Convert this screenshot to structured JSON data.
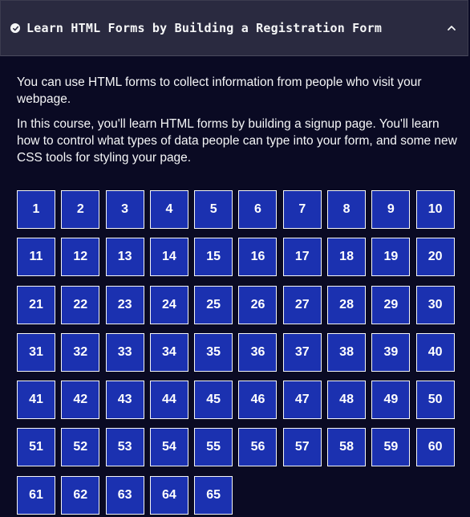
{
  "header": {
    "title": "Learn HTML Forms by Building a Registration Form",
    "completed_icon": "check-circle-icon",
    "toggle_icon": "chevron-up-icon"
  },
  "description": {
    "paragraphs": [
      "You can use HTML forms to collect information from people who visit your webpage.",
      "In this course, you'll learn HTML forms by building a signup page. You'll learn how to control what types of data people can type into your form, and some new CSS tools for styling your page."
    ]
  },
  "steps": [
    "1",
    "2",
    "3",
    "4",
    "5",
    "6",
    "7",
    "8",
    "9",
    "10",
    "11",
    "12",
    "13",
    "14",
    "15",
    "16",
    "17",
    "18",
    "19",
    "20",
    "21",
    "22",
    "23",
    "24",
    "25",
    "26",
    "27",
    "28",
    "29",
    "30",
    "31",
    "32",
    "33",
    "34",
    "35",
    "36",
    "37",
    "38",
    "39",
    "40",
    "41",
    "42",
    "43",
    "44",
    "45",
    "46",
    "47",
    "48",
    "49",
    "50",
    "51",
    "52",
    "53",
    "54",
    "55",
    "56",
    "57",
    "58",
    "59",
    "60",
    "61",
    "62",
    "63",
    "64",
    "65"
  ],
  "colors": {
    "background": "#0a0a23",
    "header_bg": "#2a2a40",
    "step_bg": "#1b31b0",
    "text": "#f5f6f7"
  }
}
